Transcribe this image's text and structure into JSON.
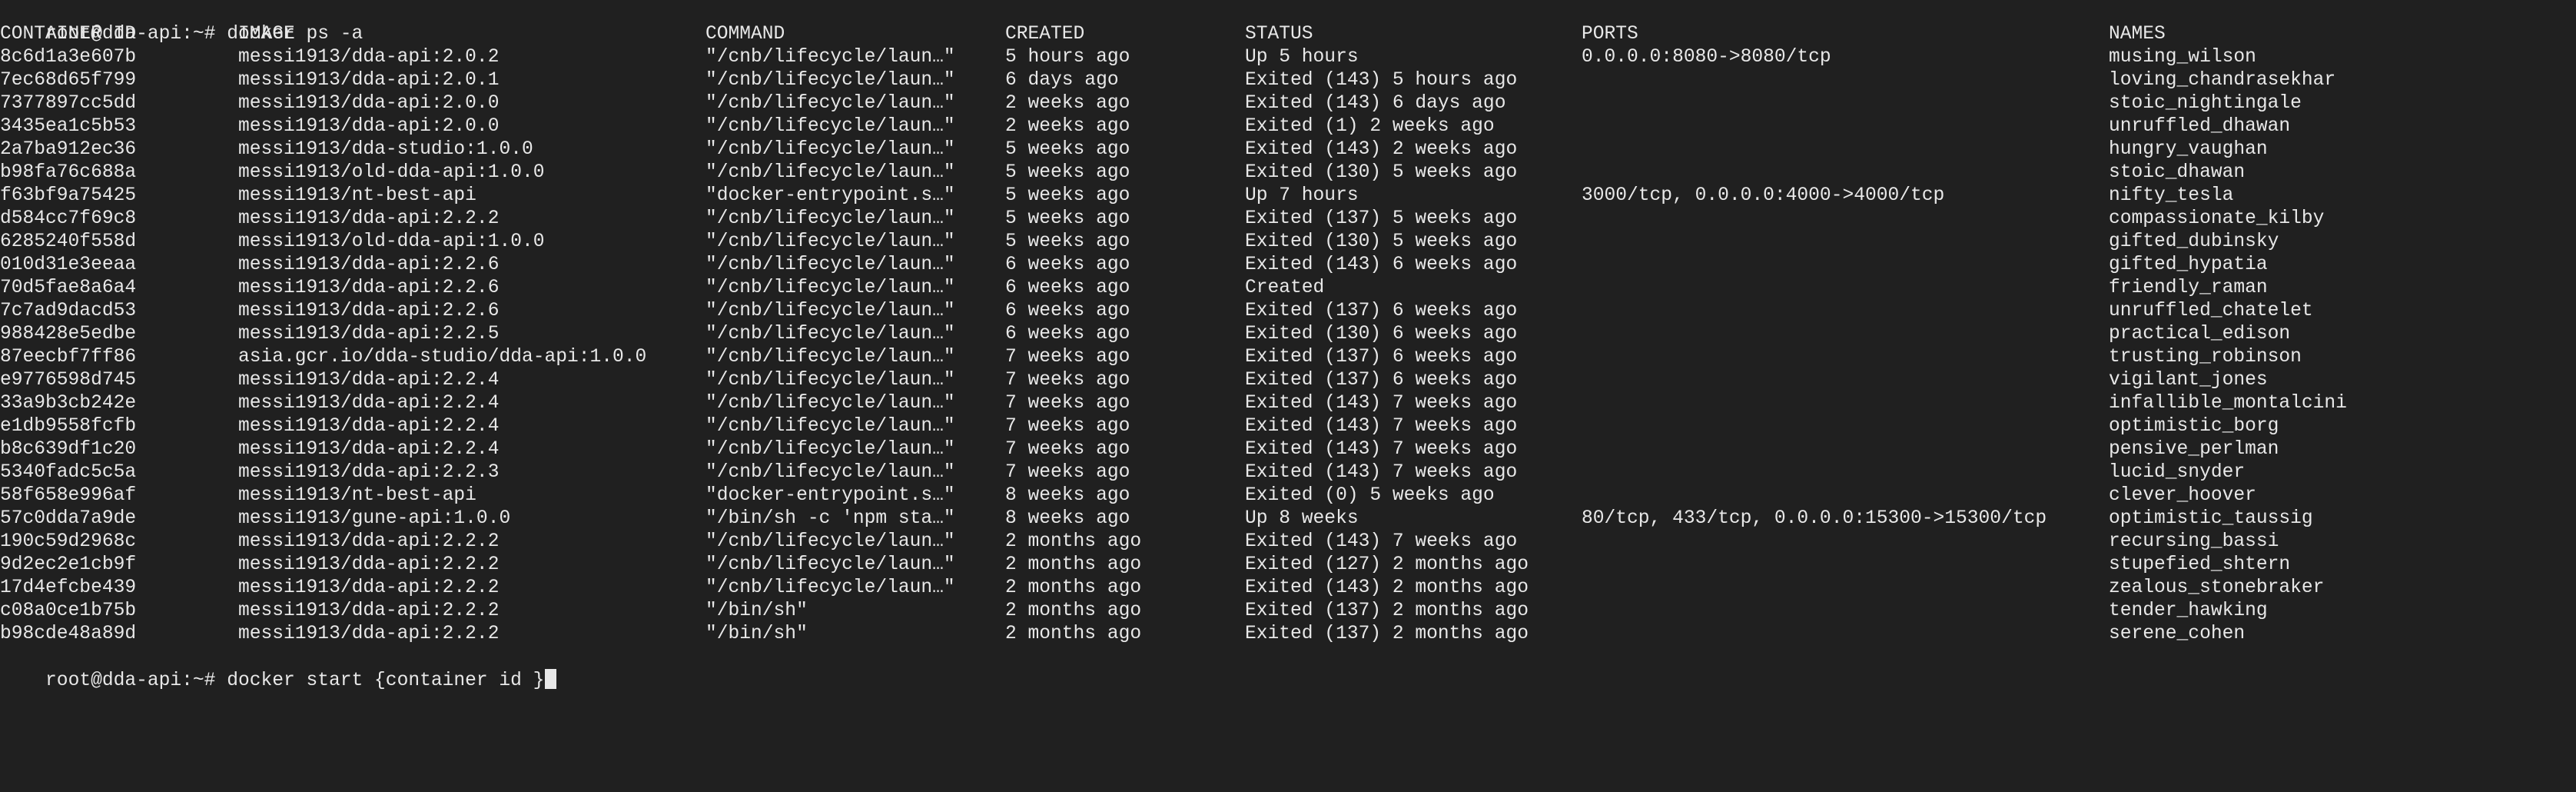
{
  "colors": {
    "background": "#202020",
    "foreground": "#e8e8e8"
  },
  "terminal": {
    "prompt": "root@dda-api:~# ",
    "command1": "docker ps -a",
    "command2": "docker start {container id }"
  },
  "table": {
    "headers": [
      "CONTAINER ID",
      "IMAGE",
      "COMMAND",
      "CREATED",
      "STATUS",
      "PORTS",
      "NAMES"
    ],
    "rows": [
      {
        "id": "8c6d1a3e607b",
        "image": "messi1913/dda-api:2.0.2",
        "command": "\"/cnb/lifecycle/laun…\"",
        "created": "5 hours ago",
        "status": "Up 5 hours",
        "ports": "0.0.0.0:8080->8080/tcp",
        "names": "musing_wilson"
      },
      {
        "id": "7ec68d65f799",
        "image": "messi1913/dda-api:2.0.1",
        "command": "\"/cnb/lifecycle/laun…\"",
        "created": "6 days ago",
        "status": "Exited (143) 5 hours ago",
        "ports": "",
        "names": "loving_chandrasekhar"
      },
      {
        "id": "7377897cc5dd",
        "image": "messi1913/dda-api:2.0.0",
        "command": "\"/cnb/lifecycle/laun…\"",
        "created": "2 weeks ago",
        "status": "Exited (143) 6 days ago",
        "ports": "",
        "names": "stoic_nightingale"
      },
      {
        "id": "3435ea1c5b53",
        "image": "messi1913/dda-api:2.0.0",
        "command": "\"/cnb/lifecycle/laun…\"",
        "created": "2 weeks ago",
        "status": "Exited (1) 2 weeks ago",
        "ports": "",
        "names": "unruffled_dhawan"
      },
      {
        "id": "2a7ba912ec36",
        "image": "messi1913/dda-studio:1.0.0",
        "command": "\"/cnb/lifecycle/laun…\"",
        "created": "5 weeks ago",
        "status": "Exited (143) 2 weeks ago",
        "ports": "",
        "names": "hungry_vaughan"
      },
      {
        "id": "b98fa76c688a",
        "image": "messi1913/old-dda-api:1.0.0",
        "command": "\"/cnb/lifecycle/laun…\"",
        "created": "5 weeks ago",
        "status": "Exited (130) 5 weeks ago",
        "ports": "",
        "names": "stoic_dhawan"
      },
      {
        "id": "f63bf9a75425",
        "image": "messi1913/nt-best-api",
        "command": "\"docker-entrypoint.s…\"",
        "created": "5 weeks ago",
        "status": "Up 7 hours",
        "ports": "3000/tcp, 0.0.0.0:4000->4000/tcp",
        "names": "nifty_tesla"
      },
      {
        "id": "d584cc7f69c8",
        "image": "messi1913/dda-api:2.2.2",
        "command": "\"/cnb/lifecycle/laun…\"",
        "created": "5 weeks ago",
        "status": "Exited (137) 5 weeks ago",
        "ports": "",
        "names": "compassionate_kilby"
      },
      {
        "id": "6285240f558d",
        "image": "messi1913/old-dda-api:1.0.0",
        "command": "\"/cnb/lifecycle/laun…\"",
        "created": "5 weeks ago",
        "status": "Exited (130) 5 weeks ago",
        "ports": "",
        "names": "gifted_dubinsky"
      },
      {
        "id": "010d31e3eeaa",
        "image": "messi1913/dda-api:2.2.6",
        "command": "\"/cnb/lifecycle/laun…\"",
        "created": "6 weeks ago",
        "status": "Exited (143) 6 weeks ago",
        "ports": "",
        "names": "gifted_hypatia"
      },
      {
        "id": "70d5fae8a6a4",
        "image": "messi1913/dda-api:2.2.6",
        "command": "\"/cnb/lifecycle/laun…\"",
        "created": "6 weeks ago",
        "status": "Created",
        "ports": "",
        "names": "friendly_raman"
      },
      {
        "id": "7c7ad9dacd53",
        "image": "messi1913/dda-api:2.2.6",
        "command": "\"/cnb/lifecycle/laun…\"",
        "created": "6 weeks ago",
        "status": "Exited (137) 6 weeks ago",
        "ports": "",
        "names": "unruffled_chatelet"
      },
      {
        "id": "988428e5edbe",
        "image": "messi1913/dda-api:2.2.5",
        "command": "\"/cnb/lifecycle/laun…\"",
        "created": "6 weeks ago",
        "status": "Exited (130) 6 weeks ago",
        "ports": "",
        "names": "practical_edison"
      },
      {
        "id": "87eecbf7ff86",
        "image": "asia.gcr.io/dda-studio/dda-api:1.0.0",
        "command": "\"/cnb/lifecycle/laun…\"",
        "created": "7 weeks ago",
        "status": "Exited (137) 6 weeks ago",
        "ports": "",
        "names": "trusting_robinson"
      },
      {
        "id": "e9776598d745",
        "image": "messi1913/dda-api:2.2.4",
        "command": "\"/cnb/lifecycle/laun…\"",
        "created": "7 weeks ago",
        "status": "Exited (137) 6 weeks ago",
        "ports": "",
        "names": "vigilant_jones"
      },
      {
        "id": "33a9b3cb242e",
        "image": "messi1913/dda-api:2.2.4",
        "command": "\"/cnb/lifecycle/laun…\"",
        "created": "7 weeks ago",
        "status": "Exited (143) 7 weeks ago",
        "ports": "",
        "names": "infallible_montalcini"
      },
      {
        "id": "e1db9558fcfb",
        "image": "messi1913/dda-api:2.2.4",
        "command": "\"/cnb/lifecycle/laun…\"",
        "created": "7 weeks ago",
        "status": "Exited (143) 7 weeks ago",
        "ports": "",
        "names": "optimistic_borg"
      },
      {
        "id": "b8c639df1c20",
        "image": "messi1913/dda-api:2.2.4",
        "command": "\"/cnb/lifecycle/laun…\"",
        "created": "7 weeks ago",
        "status": "Exited (143) 7 weeks ago",
        "ports": "",
        "names": "pensive_perlman"
      },
      {
        "id": "5340fadc5c5a",
        "image": "messi1913/dda-api:2.2.3",
        "command": "\"/cnb/lifecycle/laun…\"",
        "created": "7 weeks ago",
        "status": "Exited (143) 7 weeks ago",
        "ports": "",
        "names": "lucid_snyder"
      },
      {
        "id": "58f658e996af",
        "image": "messi1913/nt-best-api",
        "command": "\"docker-entrypoint.s…\"",
        "created": "8 weeks ago",
        "status": "Exited (0) 5 weeks ago",
        "ports": "",
        "names": "clever_hoover"
      },
      {
        "id": "57c0dda7a9de",
        "image": "messi1913/gune-api:1.0.0",
        "command": "\"/bin/sh -c 'npm sta…\"",
        "created": "8 weeks ago",
        "status": "Up 8 weeks",
        "ports": "80/tcp, 433/tcp, 0.0.0.0:15300->15300/tcp",
        "names": "optimistic_taussig"
      },
      {
        "id": "190c59d2968c",
        "image": "messi1913/dda-api:2.2.2",
        "command": "\"/cnb/lifecycle/laun…\"",
        "created": "2 months ago",
        "status": "Exited (143) 7 weeks ago",
        "ports": "",
        "names": "recursing_bassi"
      },
      {
        "id": "9d2ec2e1cb9f",
        "image": "messi1913/dda-api:2.2.2",
        "command": "\"/cnb/lifecycle/laun…\"",
        "created": "2 months ago",
        "status": "Exited (127) 2 months ago",
        "ports": "",
        "names": "stupefied_shtern"
      },
      {
        "id": "17d4efcbe439",
        "image": "messi1913/dda-api:2.2.2",
        "command": "\"/cnb/lifecycle/laun…\"",
        "created": "2 months ago",
        "status": "Exited (143) 2 months ago",
        "ports": "",
        "names": "zealous_stonebraker"
      },
      {
        "id": "c08a0ce1b75b",
        "image": "messi1913/dda-api:2.2.2",
        "command": "\"/bin/sh\"",
        "created": "2 months ago",
        "status": "Exited (137) 2 months ago",
        "ports": "",
        "names": "tender_hawking"
      },
      {
        "id": "b98cde48a89d",
        "image": "messi1913/dda-api:2.2.2",
        "command": "\"/bin/sh\"",
        "created": "2 months ago",
        "status": "Exited (137) 2 months ago",
        "ports": "",
        "names": "serene_cohen"
      }
    ]
  }
}
